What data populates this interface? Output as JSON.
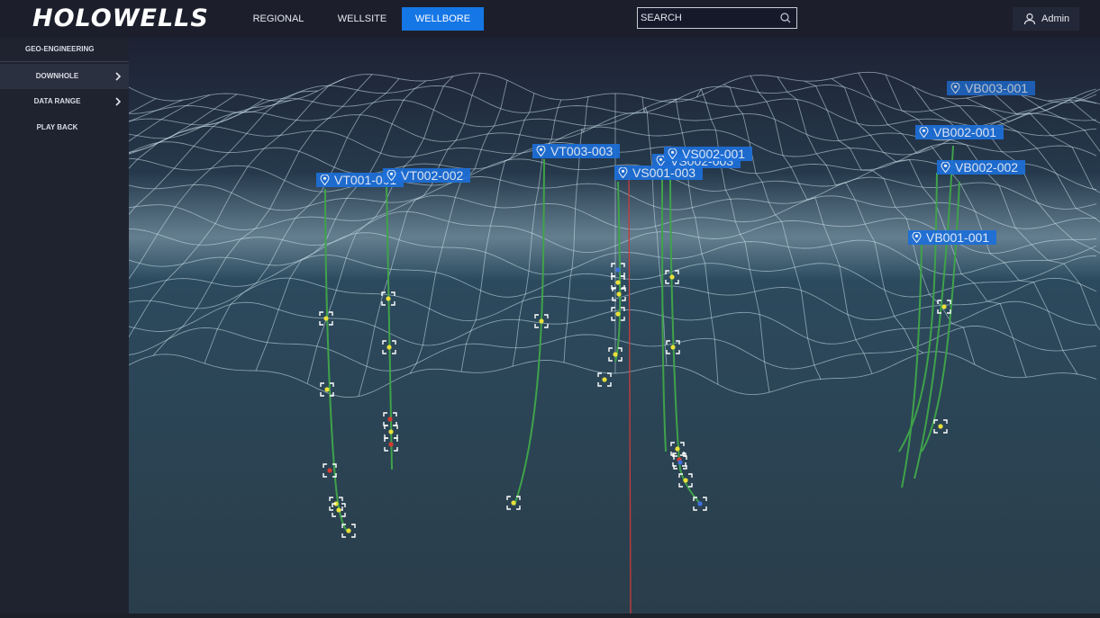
{
  "app": {
    "logo": "HOLOWELLS"
  },
  "nav": {
    "tabs": [
      {
        "label": "REGIONAL"
      },
      {
        "label": "WELLSITE"
      },
      {
        "label": "WELLBORE"
      }
    ],
    "active": "WELLBORE"
  },
  "search": {
    "placeholder": "SEARCH",
    "value": ""
  },
  "user": {
    "name": "Admin"
  },
  "sidebar": {
    "section": "GEO-ENGINEERING",
    "items": [
      {
        "label": "DOWNHOLE"
      },
      {
        "label": "DATA RANGE"
      },
      {
        "label": "PLAY BACK"
      }
    ]
  },
  "wells": {
    "labels": [
      "VT001-001",
      "VT002-002",
      "VT003-003",
      "VS002-001",
      "VS002-003",
      "VS001-003",
      "VB003-001",
      "VB002-001",
      "VB002-002",
      "VB001-001"
    ]
  },
  "colors": {
    "accent": "#1576e6",
    "trajectory": "#3fa24a",
    "vertical_marker": "#c83c3c",
    "marker_yellow": "#e8e03a",
    "marker_red": "#d63b30",
    "marker_blue": "#3f6fe0"
  }
}
